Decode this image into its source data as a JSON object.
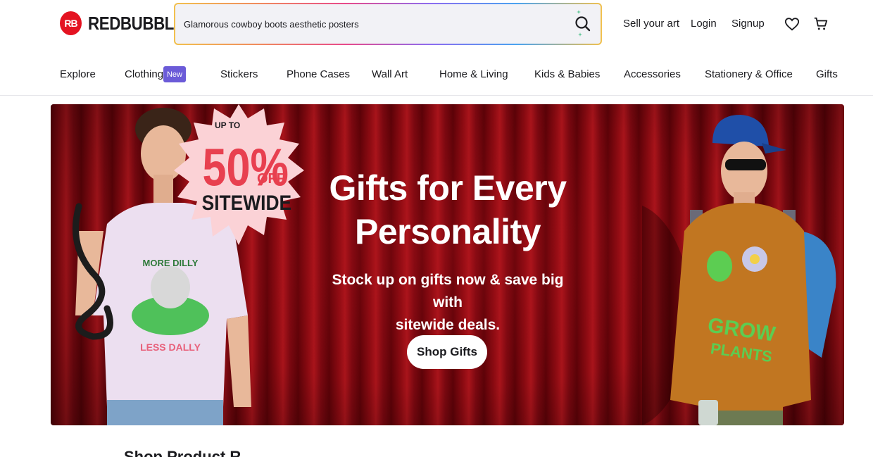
{
  "header": {
    "logo_text": "REDBUBBLE",
    "logo_mark": "RB",
    "search": {
      "value": "Glamorous cowboy boots aesthetic posters",
      "icon": "search-icon"
    },
    "links": {
      "sell": "Sell your art",
      "login": "Login",
      "signup": "Signup"
    },
    "icons": [
      "heart-icon",
      "cart-icon"
    ]
  },
  "nav": {
    "items": [
      "Explore",
      "Clothing",
      "Stickers",
      "Phone Cases",
      "Wall Art",
      "Home & Living",
      "Kids & Babies",
      "Accessories",
      "Stationery & Office",
      "Gifts"
    ],
    "badge": "New"
  },
  "hero": {
    "promo_small": "UP TO",
    "promo_big": "50%",
    "promo_off": "OFF",
    "promo_bottom": "SITEWIDE",
    "title_line1": "Gifts for Every",
    "title_line2": "Personality",
    "subtitle_line1": "Stock up on gifts now & save big with",
    "subtitle_line2": "sitewide deals.",
    "cta": "Shop Gifts",
    "shirt_left_top": "MORE DILLY",
    "shirt_left_bottom": "LESS DALLY",
    "shirt_right_top": "GROW",
    "shirt_right_bottom": "PLANTS",
    "colors": {
      "curtain": "#8c0b12",
      "promo_bg": "#fbd2d6",
      "promo_red": "#e8404f",
      "brand": "#e41321",
      "badge": "#6b5bd8"
    }
  },
  "below": {
    "section_title": "Shop Product R"
  }
}
